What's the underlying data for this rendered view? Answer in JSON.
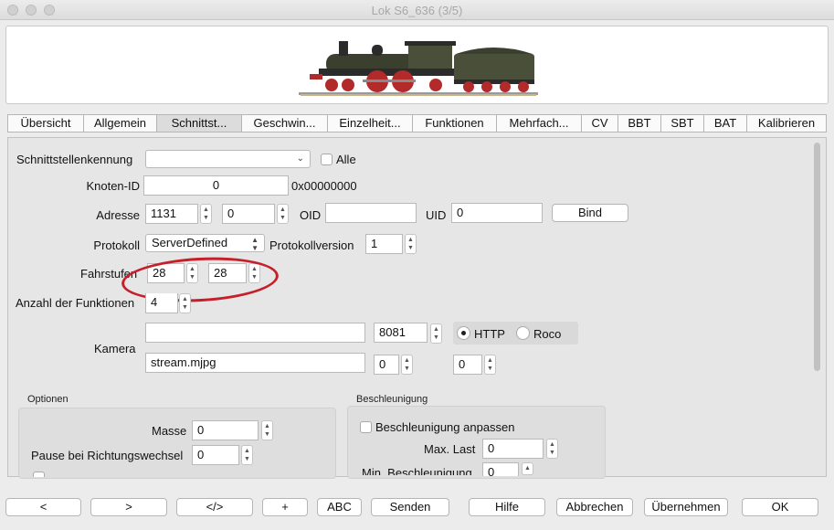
{
  "window": {
    "title": "Lok S6_636 (3/5)"
  },
  "tabs": [
    "Übersicht",
    "Allgemein",
    "Schnittst...",
    "Geschwin...",
    "Einzelheit...",
    "Funktionen",
    "Mehrfach...",
    "CV",
    "BBT",
    "SBT",
    "BAT",
    "Kalibrieren"
  ],
  "active_tab": "Schnittst...",
  "form": {
    "schnittstellenkennung": {
      "label": "Schnittstellenkennung",
      "value": ""
    },
    "alle": {
      "label": "Alle",
      "checked": false
    },
    "knoten_id": {
      "label": "Knoten-ID",
      "value": "0",
      "hex": "0x00000000"
    },
    "adresse": {
      "label": "Adresse",
      "value": "1131",
      "value2": "0"
    },
    "oid": {
      "label": "OID",
      "value": ""
    },
    "uid": {
      "label": "UID",
      "value": "0"
    },
    "bind": {
      "label": "Bind"
    },
    "protokoll": {
      "label": "Protokoll",
      "value": "ServerDefined"
    },
    "protokollversion": {
      "label": "Protokollversion",
      "value": "1"
    },
    "fahrstufen": {
      "label": "Fahrstufen",
      "value1": "28",
      "value2": "28"
    },
    "anzahl_funktionen": {
      "label": "Anzahl der Funktionen",
      "value": "4"
    },
    "kamera": {
      "label": "Kamera",
      "host": "",
      "port": "8081",
      "http": {
        "label": "HTTP",
        "selected": true
      },
      "roco": {
        "label": "Roco",
        "selected": false
      },
      "path": "stream.mjpg",
      "val1": "0",
      "val2": "0"
    }
  },
  "optionen": {
    "title": "Optionen",
    "masse": {
      "label": "Masse",
      "value": "0"
    },
    "pause": {
      "label": "Pause bei Richtungswechsel",
      "value": "0"
    }
  },
  "beschleunigung": {
    "title": "Beschleunigung",
    "anpassen": {
      "label": "Beschleunigung anpassen",
      "checked": false
    },
    "max_last": {
      "label": "Max. Last",
      "value": "0"
    },
    "min_beschl": {
      "label": "Min. Beschleunigung",
      "value": "0"
    }
  },
  "buttons": {
    "prev": "<",
    "next": ">",
    "code": "</>",
    "plus": "+",
    "abc": "ABC",
    "senden": "Senden",
    "hilfe": "Hilfe",
    "abbrechen": "Abbrechen",
    "uebernehmen": "Übernehmen",
    "ok": "OK"
  },
  "colors": {
    "annotation_circle": "#c61f2a",
    "train_body": "#4a4f3a",
    "train_wheels": "#b22a2a"
  },
  "icons": {
    "spinner": "up-down-arrows-icon",
    "combo": "chevron-down-icon",
    "banner": "steam-locomotive-image"
  }
}
